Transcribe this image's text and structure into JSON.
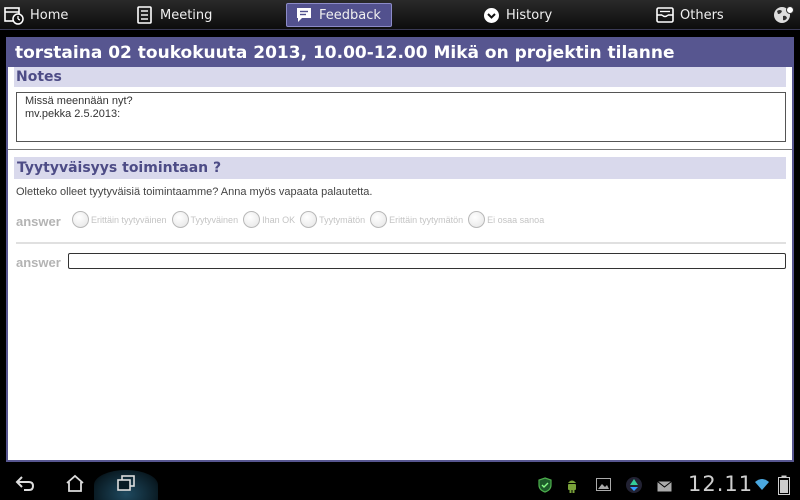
{
  "tabs": [
    {
      "label": "Home",
      "icon": "calendar-clock-icon"
    },
    {
      "label": "Meeting",
      "icon": "document-icon"
    },
    {
      "label": "Feedback",
      "icon": "speech-bubble-icon",
      "active": true
    },
    {
      "label": "History",
      "icon": "chevron-down-circle-icon"
    },
    {
      "label": "Others",
      "icon": "inbox-icon"
    },
    {
      "label": "",
      "icon": "globe-settings-icon"
    }
  ],
  "header": {
    "title": "torstaina 02 toukokuuta 2013, 10.00-12.00  Mikä on projektin tilanne"
  },
  "notes": {
    "heading": "Notes",
    "text": "Missä meennään nyt?\nmv.pekka 2.5.2013:"
  },
  "question": {
    "heading": "Tyytyväisyys toimintaan ?",
    "description": "Oletteko olleet tyytyväisiä toimintaamme? Anna myös vapaata palautetta.",
    "answer_label": "answer",
    "options": [
      "Erittäin tyytyväinen",
      "Tyytyväinen",
      "Ihan OK",
      "Tyytymätön",
      "Erittäin tyytymätön",
      "Ei osaa sanoa"
    ],
    "free_answer_label": "answer",
    "free_answer_value": ""
  },
  "system_bar": {
    "clock": "12.11",
    "status_icons": [
      "shield-icon",
      "android-icon",
      "image-icon",
      "recycle-icon",
      "mail-icon",
      "wifi-icon",
      "battery-icon"
    ]
  },
  "colors": {
    "accent": "#575690",
    "section_bg": "#d9d9ec",
    "section_text": "#4d4c86"
  }
}
